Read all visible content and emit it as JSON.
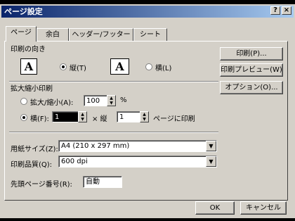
{
  "window": {
    "title": "ページ設定",
    "help_label": "?",
    "close_label": "×"
  },
  "tabs": [
    {
      "label": "ページ"
    },
    {
      "label": "余白"
    },
    {
      "label": "ヘッダー/フッター"
    },
    {
      "label": "シート"
    }
  ],
  "orientation": {
    "group_label": "印刷の向き",
    "portrait_glyph": "A",
    "landscape_glyph": "A",
    "portrait_label": "縦(T)",
    "landscape_label": "横(L)",
    "selected": "portrait"
  },
  "scaling": {
    "group_label": "拡大縮小印刷",
    "zoom_label": "拡大/縮小(A):",
    "zoom_value": "100",
    "percent_unit": "%",
    "fit_label": "横(F):",
    "fit_wide_value": "1",
    "times_label": "× 縦",
    "fit_tall_value": "1",
    "fit_suffix": "ページに印刷",
    "selected": "fit"
  },
  "paper": {
    "paper_size_label": "用紙サイズ(Z):",
    "paper_size_value": "A4 (210 x 297 mm)",
    "quality_label": "印刷品質(Q):",
    "quality_value": "600 dpi",
    "first_page_label": "先頭ページ番号(R):",
    "first_page_value": "自動"
  },
  "side_buttons": {
    "print": "印刷(P)...",
    "preview": "印刷プレビュー(W)",
    "options": "オプション(O)..."
  },
  "footer": {
    "ok": "OK",
    "cancel": "キャンセル"
  }
}
